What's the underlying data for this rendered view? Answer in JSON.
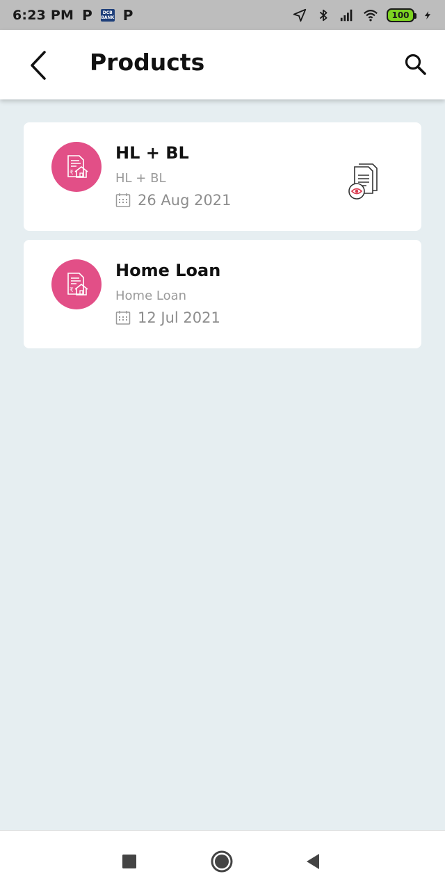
{
  "status_bar": {
    "time": "6:23 PM",
    "notif_p": "P",
    "bank_label": "DCB BANK",
    "battery_level": "100"
  },
  "app_bar": {
    "title": "Products",
    "icons": {
      "back": "back-arrow-icon",
      "search": "search-icon"
    }
  },
  "products": [
    {
      "title": "HL + BL",
      "subtitle": "HL + BL",
      "date": "26 Aug 2021",
      "has_document": true
    },
    {
      "title": "Home Loan",
      "subtitle": "Home Loan",
      "date": "12 Jul 2021",
      "has_document": false
    }
  ],
  "colors": {
    "accent": "#e24f87",
    "background": "#e6eef1",
    "card": "#ffffff",
    "status_bar": "#bdbdbd"
  }
}
